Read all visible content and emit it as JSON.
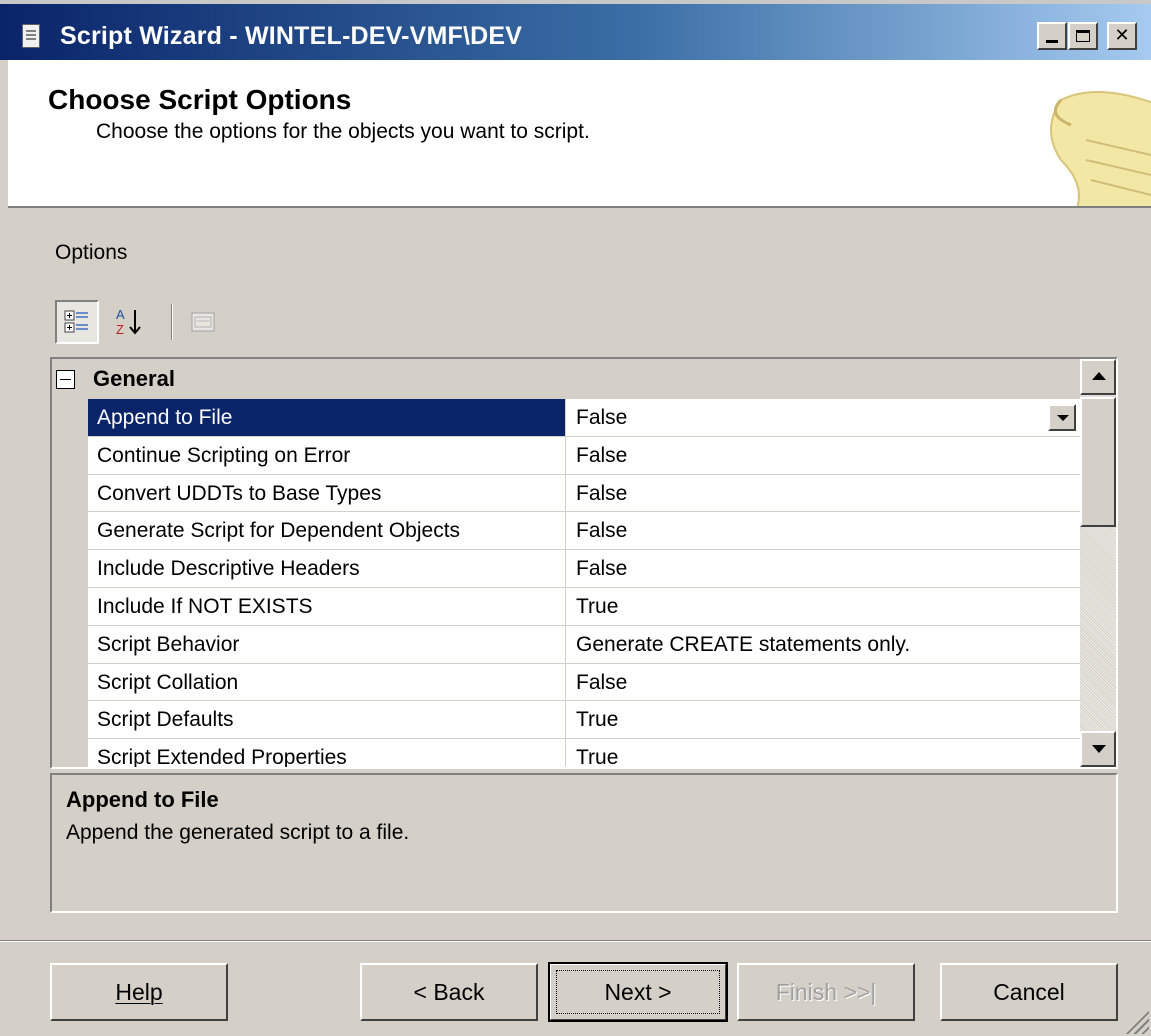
{
  "window": {
    "title": "Script Wizard - WINTEL-DEV-VMF\\DEV",
    "controls": [
      "minimize",
      "maximize",
      "close"
    ]
  },
  "header": {
    "title": "Choose Script Options",
    "subtitle": "Choose the options for the objects you want to script."
  },
  "options": {
    "label": "Options"
  },
  "grid": {
    "category": "General",
    "rows": [
      {
        "name": "Append to File",
        "value": "False"
      },
      {
        "name": "Continue Scripting on Error",
        "value": "False"
      },
      {
        "name": "Convert UDDTs to Base Types",
        "value": "False"
      },
      {
        "name": "Generate Script for Dependent Objects",
        "value": "False"
      },
      {
        "name": "Include Descriptive Headers",
        "value": "False"
      },
      {
        "name": "Include If NOT EXISTS",
        "value": "True"
      },
      {
        "name": "Script Behavior",
        "value": "Generate CREATE statements only."
      },
      {
        "name": "Script Collation",
        "value": "False"
      },
      {
        "name": "Script Defaults",
        "value": "True"
      },
      {
        "name": "Script Extended Properties",
        "value": "True"
      }
    ],
    "selected_index": 0
  },
  "description": {
    "title": "Append to File",
    "text": "Append the generated script to a file."
  },
  "buttons": {
    "help": "Help",
    "back": "< Back",
    "next": "Next >",
    "finish": "Finish >>|",
    "cancel": "Cancel"
  },
  "colors": {
    "selection": "#0a246a",
    "face": "#d4d0c8"
  }
}
